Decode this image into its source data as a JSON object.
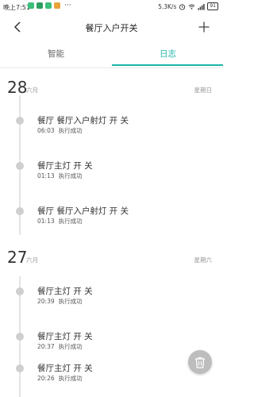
{
  "status_bar": {
    "time": "晚上7:51",
    "dots": "···",
    "speed": "5.3K/s",
    "battery": "91",
    "app_colors": [
      "#3bbf7a",
      "#2f9e63",
      "#3bbf7a",
      "#e8a33a"
    ]
  },
  "header": {
    "title": "餐厅入户开关",
    "back_icon": "back-arrow-icon",
    "add_icon": "plus-icon"
  },
  "tabs": [
    {
      "label": "智能",
      "active": false
    },
    {
      "label": "日志",
      "active": true
    }
  ],
  "accent_color": "#1db5a8",
  "log": {
    "days": [
      {
        "day": "28",
        "month": "六月",
        "weekday": "星期日",
        "entries": [
          {
            "title": "餐厅 餐厅入户射灯 开 关",
            "time": "06:03",
            "status": "执行成功"
          },
          {
            "title": "餐厅主灯 开 关",
            "time": "01:13",
            "status": "执行成功"
          },
          {
            "title": "餐厅 餐厅入户射灯 开 关",
            "time": "01:13",
            "status": "执行成功"
          }
        ]
      },
      {
        "day": "27",
        "month": "六月",
        "weekday": "星期六",
        "entries": [
          {
            "title": "餐厅主灯 开 关",
            "time": "20:39",
            "status": "执行成功"
          },
          {
            "title": "餐厅主灯 开 关",
            "time": "20:37",
            "status": "执行成功"
          },
          {
            "title": "餐厅主灯 开 关",
            "time": "20:26",
            "status": "执行成功"
          }
        ]
      }
    ]
  },
  "fab": {
    "icon": "trash-icon"
  }
}
